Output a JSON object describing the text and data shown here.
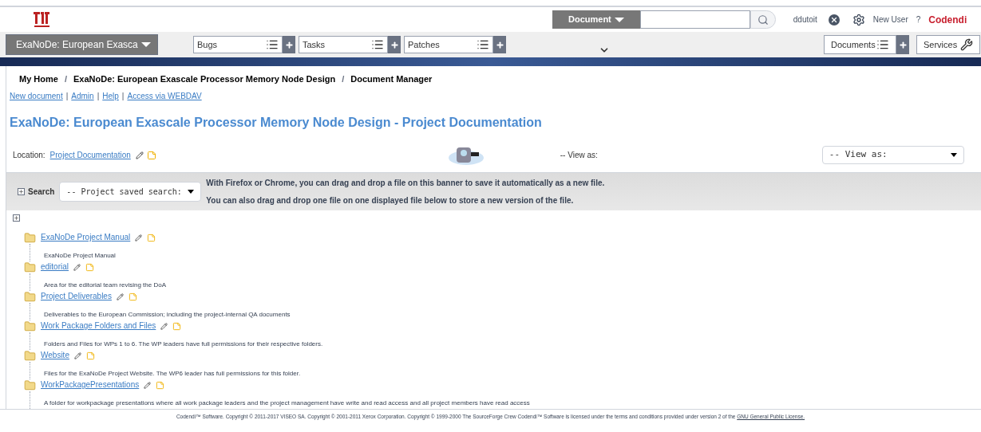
{
  "header": {
    "search_type": "Document",
    "user": "ddutoit",
    "new_user": "New User",
    "help": "?",
    "brand": "Codendi"
  },
  "navbar": {
    "project": "ExaNoDe: European Exasca",
    "trackers": [
      "Bugs",
      "Tasks",
      "Patches"
    ],
    "documents": "Documents",
    "services": "Services"
  },
  "breadcrumb_separator": "/",
  "link_separator": "|",
  "breadcrumb": [
    "My Home",
    "ExaNoDe: European Exascale Processor Memory Node Design",
    "Document Manager"
  ],
  "links": [
    "New document",
    "Admin",
    "Help",
    "Access via WEBDAV"
  ],
  "title": "ExaNoDe: European Exascale Processor Memory Node Design - Project Documentation",
  "location": {
    "label": "Location:",
    "link": "Project Documentation"
  },
  "view_as": {
    "label": "-- View as:",
    "select": "-- View as:"
  },
  "search": {
    "label": "Search",
    "select": "-- Project saved search:",
    "hints": [
      "With Firefox or Chrome, you can drag and drop a file on this banner to save it automatically as a new file.",
      "You can also drag and drop one file on one displayed file below to store a new version of the file."
    ]
  },
  "folders": [
    {
      "name": "ExaNoDe Project Manual",
      "description": "ExaNoDe Project Manual"
    },
    {
      "name": "editorial",
      "description": "Area for the editorial team revising the DoA"
    },
    {
      "name": "Project Deliverables",
      "description": "Deliverables to the European Commission; including the project-internal QA documents"
    },
    {
      "name": "Work Package Folders and Files",
      "description": "Folders and Files for WPs 1 to 6. The WP leaders have full permissions for their respective folders."
    },
    {
      "name": "Website",
      "description": "Files for the ExaNoDe Project Website. The WP6 leader has full permissions for this folder."
    },
    {
      "name": "WorkPackagePresentations",
      "description": "A folder for workpackage presentations where all work package leaders and the project management have write and read access and all project members have read access"
    }
  ],
  "footer": {
    "text": "Codendi™ Software. Copyright © 2011-2017 VISEO SA. Copyright © 2001-2011 Xerox Corporation. Copyright © 1999-2000 The SourceForge Crew Codendi™ Software is licensed under the terms and conditions provided under version 2 of the",
    "link": "GNU General Public License."
  }
}
